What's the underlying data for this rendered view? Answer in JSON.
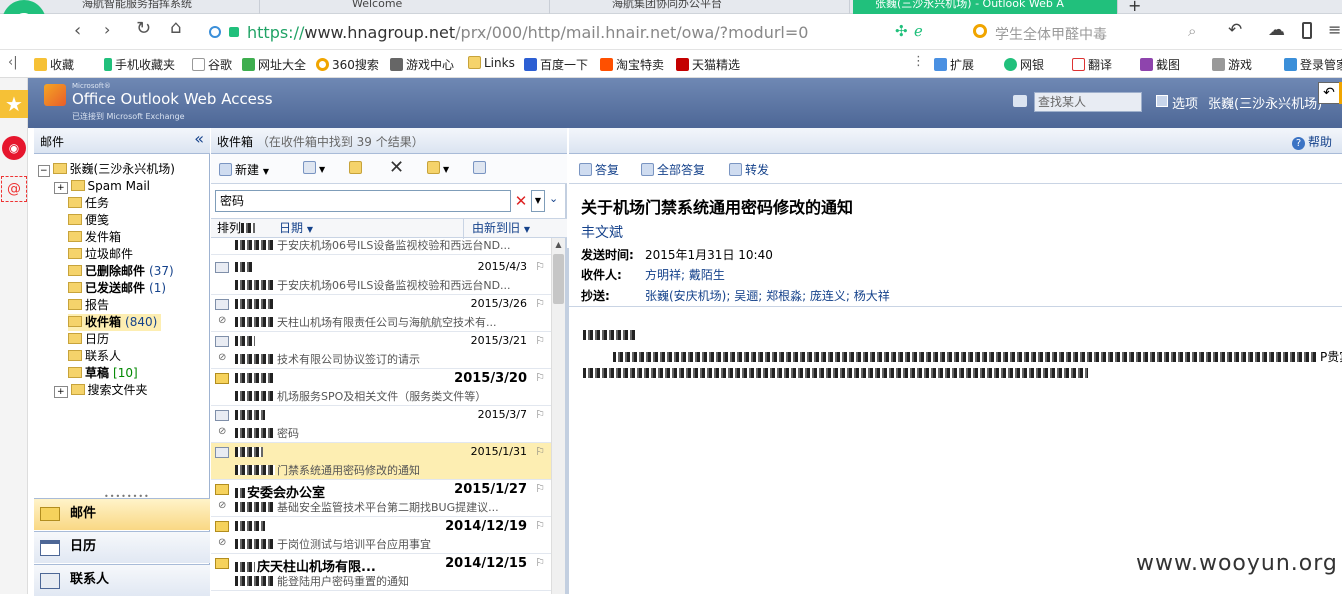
{
  "browser": {
    "tabs": [
      "海航智能服务指挥系统",
      "Welcome",
      "海航集团协同办公平台",
      "张巍(三沙永兴机场) - Outlook Web A"
    ],
    "url_prefix": "https://",
    "url_host": "www.hnagroup.net",
    "url_path": "/prx/000/http/mail.hnair.net/owa/?modurl=0",
    "search_text": "学生全体甲醛中毒",
    "bookmarks": [
      "收藏",
      "手机收藏夹",
      "谷歌",
      "网址大全",
      "360搜索",
      "游戏中心",
      "Links",
      "百度一下",
      "淘宝特卖",
      "天猫精选"
    ],
    "right_tools": [
      "扩展",
      "网银",
      "翻译",
      "截图",
      "游戏",
      "登录管家"
    ]
  },
  "owa": {
    "brand_small": "Microsoft®",
    "brand": "Office Outlook Web Access",
    "brand_sub": "已连接到 Microsoft Exchange",
    "search_people_placeholder": "查找某人",
    "options_label": "选项",
    "user_label": "张巍(三沙永兴机场)",
    "help_label": "帮助"
  },
  "folders": {
    "header": "邮件",
    "root": "张巍(三沙永兴机场)",
    "items": [
      {
        "label": "Spam Mail",
        "count": ""
      },
      {
        "label": "任务",
        "count": ""
      },
      {
        "label": "便笺",
        "count": ""
      },
      {
        "label": "发件箱",
        "count": ""
      },
      {
        "label": "垃圾邮件",
        "count": ""
      },
      {
        "label": "已删除邮件",
        "count": "(37)"
      },
      {
        "label": "已发送邮件",
        "count": "(1)"
      },
      {
        "label": "报告",
        "count": ""
      },
      {
        "label": "收件箱",
        "count": "(840)"
      },
      {
        "label": "日历",
        "count": ""
      },
      {
        "label": "联系人",
        "count": ""
      },
      {
        "label": "草稿",
        "count": "[10]"
      },
      {
        "label": "搜索文件夹",
        "count": ""
      }
    ],
    "nav": [
      "邮件",
      "日历",
      "联系人"
    ]
  },
  "list": {
    "title": "收件箱",
    "result": "（在收件箱中找到 39 个结果）",
    "new_label": "新建",
    "search_value": "密码",
    "sort_label": "排列",
    "sort_by": "日期",
    "sort_order": "由新到旧",
    "messages": [
      {
        "sender": "",
        "date": "",
        "subject": "于安庆机场06号ILS设备监视校验和西远台ND...",
        "unread": false
      },
      {
        "sender": "",
        "date": "2015/4/3",
        "subject": "于安庆机场06号ILS设备监视校验和西远台ND...",
        "unread": false
      },
      {
        "sender": "",
        "date": "2015/3/26",
        "subject": "天柱山机场有限责任公司与海航航空技术有...",
        "unread": false
      },
      {
        "sender": "",
        "date": "2015/3/21",
        "subject": "技术有限公司协议签订的请示",
        "unread": false
      },
      {
        "sender": "",
        "date": "2015/3/20",
        "subject": "机场服务SPO及相关文件（服务类文件等）",
        "unread": true
      },
      {
        "sender": "",
        "date": "2015/3/7",
        "subject": "密码",
        "unread": false
      },
      {
        "sender": "",
        "date": "2015/1/31",
        "subject": "门禁系统通用密码修改的通知",
        "unread": false
      },
      {
        "sender": "安委会办公室",
        "date": "2015/1/27",
        "subject": "基础安全监管技术平台第二期找BUG提建议...",
        "unread": true
      },
      {
        "sender": "",
        "date": "2014/12/19",
        "subject": "于岗位测试与培训平台应用事宜",
        "unread": true
      },
      {
        "sender": "庆天柱山机场有限...",
        "date": "2014/12/15",
        "subject": "能登陆用户密码重置的通知",
        "unread": true
      }
    ]
  },
  "reading": {
    "reply": "答复",
    "reply_all": "全部答复",
    "forward": "转发",
    "title": "关于机场门禁系统通用密码修改的通知",
    "from": "丰文斌",
    "sent_label": "发送时间:",
    "sent_value": "2015年1月31日  10:40",
    "to_label": "收件人:",
    "to_value": "方明祥; 戴陌生",
    "cc_label": "抄送:",
    "cc_value": "张巍(安庆机场); 吴逦; 郑根淼; 庞连义; 杨大祥",
    "body_tail": "P贵宾"
  },
  "watermark": "www.wooyun.org"
}
